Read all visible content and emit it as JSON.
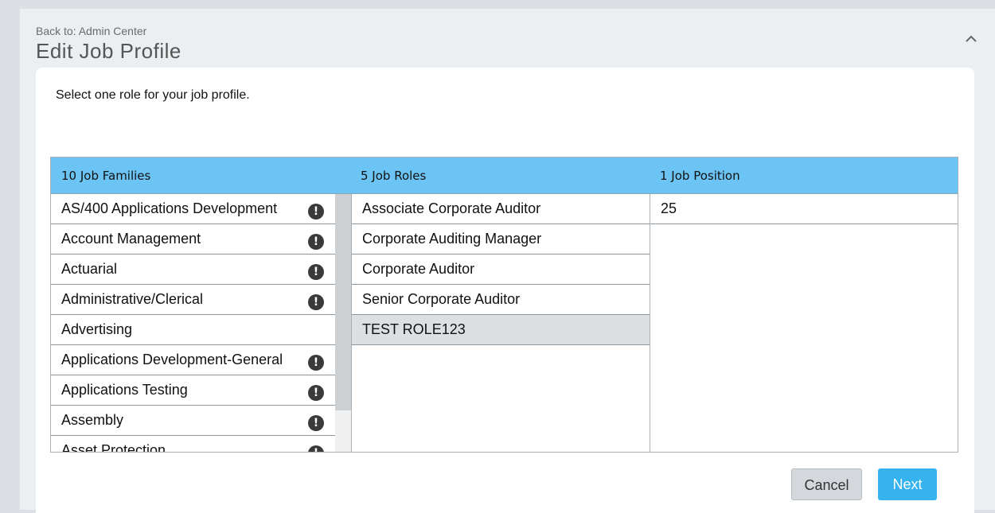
{
  "header": {
    "back_link": "Back to: Admin Center",
    "title": "Edit Job Profile",
    "collapse_icon": "chevron-up-icon"
  },
  "instruction": "Select one role for your job profile.",
  "grid": {
    "headers": [
      "10 Job Families",
      "5 Job Roles",
      "1 Job Position"
    ],
    "families": [
      {
        "label": "AS/400 Applications Development",
        "warning": true
      },
      {
        "label": "Account Management",
        "warning": true
      },
      {
        "label": "Actuarial",
        "warning": true
      },
      {
        "label": "Administrative/Clerical",
        "warning": true
      },
      {
        "label": "Advertising",
        "warning": false
      },
      {
        "label": "Applications Development-General",
        "warning": true
      },
      {
        "label": "Applications Testing",
        "warning": true
      },
      {
        "label": "Assembly",
        "warning": true
      },
      {
        "label": "Asset Protection",
        "warning": true
      }
    ],
    "roles": [
      {
        "label": "Associate Corporate Auditor",
        "selected": false
      },
      {
        "label": "Corporate Auditing Manager",
        "selected": false
      },
      {
        "label": "Corporate Auditor",
        "selected": false
      },
      {
        "label": "Senior Corporate Auditor",
        "selected": false
      },
      {
        "label": "TEST ROLE123",
        "selected": true
      }
    ],
    "positions": [
      {
        "label": "25"
      }
    ],
    "warning_icon": "exclamation-circle-icon"
  },
  "buttons": {
    "cancel": "Cancel",
    "next": "Next"
  }
}
